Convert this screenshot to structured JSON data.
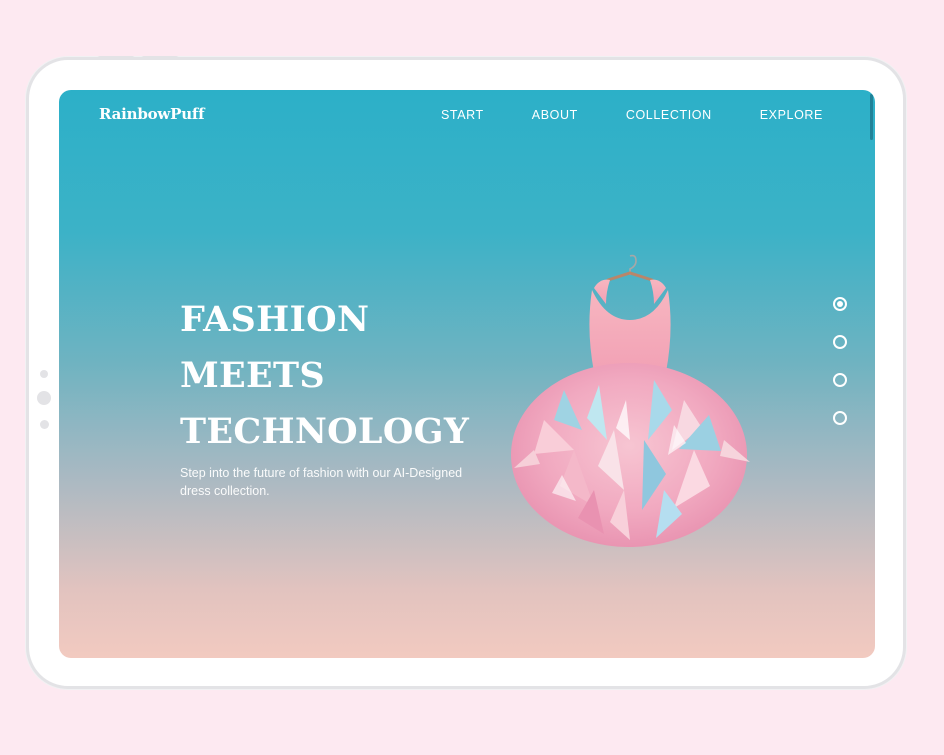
{
  "brand": {
    "logo_text": "RainbowPuff"
  },
  "nav": {
    "items": [
      {
        "label": "START"
      },
      {
        "label": "ABOUT"
      },
      {
        "label": "COLLECTION"
      },
      {
        "label": "EXPLORE"
      }
    ]
  },
  "hero": {
    "headline_lines": [
      "FASHION",
      "MEETS",
      "TECHNOLOGY"
    ],
    "subtitle": "Step into the future of fashion with our AI-Designed dress collection.",
    "image_icon": "pink-feather-dress-on-hanger"
  },
  "pager": {
    "count": 4,
    "active_index": 0
  },
  "colors": {
    "page_background": "#fde9f1",
    "gradient_top": "#2cb0c8",
    "gradient_bottom": "#f2cac0",
    "text": "#ffffff"
  }
}
